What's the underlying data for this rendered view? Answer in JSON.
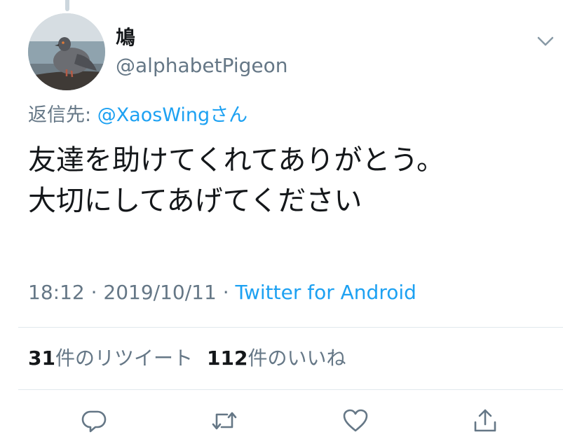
{
  "tweet": {
    "display_name": "鳩",
    "handle": "@alphabetPigeon",
    "reply_prefix": "返信先: ",
    "reply_to": "@XaosWingさん",
    "text_lines": [
      "友達を助けてくれてありがとう。",
      "大切にしてあげてください"
    ],
    "time": "18:12",
    "separator": " · ",
    "date": "2019/10/11",
    "source": "Twitter for Android"
  },
  "stats": {
    "retweets_count": "31",
    "retweets_label": "件のリツイート",
    "likes_count": "112",
    "likes_label": "件のいいね"
  },
  "icons": {
    "caret": "chevron-down-icon",
    "reply": "reply-icon",
    "retweet": "retweet-icon",
    "like": "heart-icon",
    "share": "share-icon"
  },
  "colors": {
    "link": "#1da1f2",
    "secondary_text": "#657786",
    "primary_text": "#14171a",
    "divider": "#e1e8ed"
  }
}
